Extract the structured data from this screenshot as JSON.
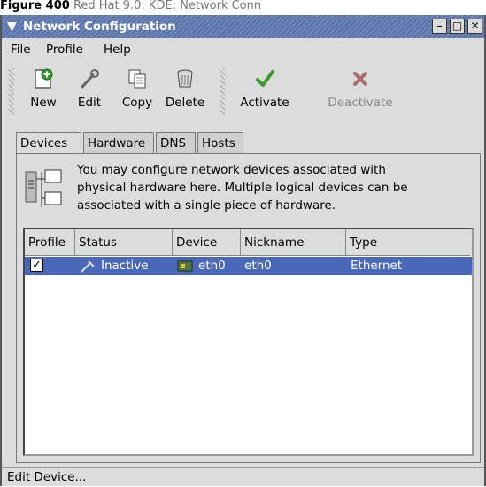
{
  "caption": {
    "figure_label": "Figure 400",
    "text": "Red Hat 9.0: KDE: Network Conn"
  },
  "window": {
    "title": "Network Configuration"
  },
  "menubar": {
    "file": "File",
    "profile": "Profile",
    "help": "Help"
  },
  "toolbar": {
    "new": "New",
    "edit": "Edit",
    "copy": "Copy",
    "delete": "Delete",
    "activate": "Activate",
    "deactivate": "Deactivate"
  },
  "tabs": {
    "devices": "Devices",
    "hardware": "Hardware",
    "dns": "DNS",
    "hosts": "Hosts",
    "active": "Devices"
  },
  "info": {
    "line1": "You may configure network devices associated with",
    "line2": "physical hardware here.  Multiple logical devices can be",
    "line3": "associated with a single piece of hardware."
  },
  "table": {
    "columns": {
      "profile": "Profile",
      "status": "Status",
      "device": "Device",
      "nickname": "Nickname",
      "type": "Type"
    },
    "rows": [
      {
        "profile_checked": true,
        "status": "Inactive",
        "device": "eth0",
        "nickname": "eth0",
        "type": "Ethernet"
      }
    ]
  },
  "statusbar": {
    "text": "Edit Device..."
  },
  "icons": {
    "new": "add-icon",
    "edit": "wrench-icon",
    "copy": "copy-icon",
    "delete": "trash-icon",
    "activate": "checkmark-icon",
    "deactivate": "x-icon"
  },
  "colors": {
    "titlebar": "#5b72a8",
    "selection": "#4a68b7",
    "window_bg": "#dcdcdc"
  }
}
